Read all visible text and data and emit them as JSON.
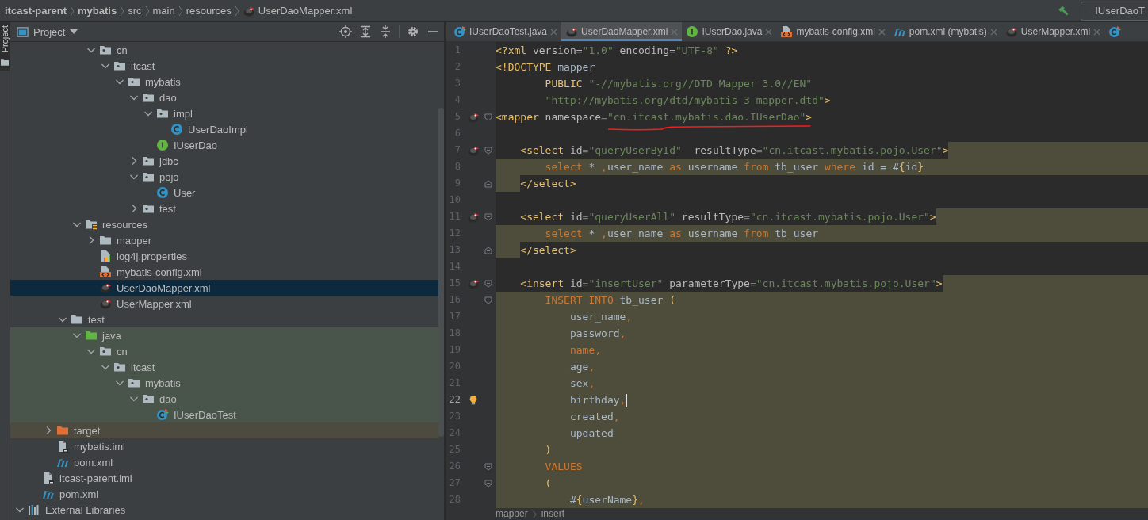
{
  "navbar": {
    "crumbs": [
      {
        "label": "itcast-parent",
        "kind": "module"
      },
      {
        "label": "mybatis",
        "kind": "module"
      },
      {
        "label": "src",
        "kind": "folder"
      },
      {
        "label": "main",
        "kind": "folder"
      },
      {
        "label": "resources",
        "kind": "folder"
      },
      {
        "label": "UserDaoMapper.xml",
        "kind": "mapper-file"
      }
    ],
    "run_config": {
      "label": "IUserDaoT"
    }
  },
  "tool_stripe": [
    {
      "label": "Project",
      "selected": true
    }
  ],
  "project": {
    "title": "Project",
    "tree": [
      {
        "children": [
          {
            "children": [
              {
                "children": [
                  {
                    "children": [
                      {
                        "children": [
                          {
                            "label": "cn",
                            "kind": "package",
                            "expanded": true,
                            "selected": false,
                            "children": [
                              {
                                "label": "itcast",
                                "kind": "package",
                                "expanded": true,
                                "selected": false,
                                "children": [
                                  {
                                    "label": "mybatis",
                                    "kind": "package",
                                    "expanded": true,
                                    "selected": false,
                                    "children": [
                                      {
                                        "label": "dao",
                                        "kind": "package",
                                        "expanded": true,
                                        "selected": false,
                                        "children": [
                                          {
                                            "label": "impl",
                                            "kind": "package",
                                            "expanded": true,
                                            "selected": false,
                                            "children": [
                                              {
                                                "label": "UserDaoImpl",
                                                "kind": "java-class",
                                                "selected": false
                                              }
                                            ]
                                          },
                                          {
                                            "label": "IUserDao",
                                            "kind": "interface",
                                            "selected": false
                                          }
                                        ]
                                      },
                                      {
                                        "label": "jdbc",
                                        "kind": "package",
                                        "expanded": false,
                                        "selected": false
                                      },
                                      {
                                        "label": "pojo",
                                        "kind": "package",
                                        "expanded": true,
                                        "selected": false,
                                        "children": [
                                          {
                                            "label": "User",
                                            "kind": "java-class",
                                            "selected": false
                                          }
                                        ]
                                      },
                                      {
                                        "label": "test",
                                        "kind": "package",
                                        "expanded": false,
                                        "selected": false
                                      }
                                    ]
                                  }
                                ]
                              }
                            ]
                          }
                        ]
                      },
                      {
                        "label": "resources",
                        "kind": "resources",
                        "expanded": true,
                        "selected": false,
                        "children": [
                          {
                            "label": "mapper",
                            "kind": "folder",
                            "expanded": false,
                            "selected": false
                          },
                          {
                            "label": "log4j.properties",
                            "kind": "properties",
                            "selected": false
                          },
                          {
                            "label": "mybatis-config.xml",
                            "kind": "xml-config",
                            "selected": false
                          },
                          {
                            "label": "UserDaoMapper.xml",
                            "kind": "mybatis",
                            "selected": true
                          },
                          {
                            "label": "UserMapper.xml",
                            "kind": "mybatis",
                            "selected": false
                          }
                        ]
                      }
                    ]
                  },
                  {
                    "label": "test",
                    "kind": "folder",
                    "expanded": true,
                    "selected": false,
                    "children": [
                      {
                        "label": "java",
                        "kind": "test-root",
                        "expanded": true,
                        "selected": false,
                        "children": [
                          {
                            "label": "cn",
                            "kind": "package",
                            "expanded": true,
                            "selected": false,
                            "children": [
                              {
                                "label": "itcast",
                                "kind": "package",
                                "expanded": true,
                                "selected": false,
                                "children": [
                                  {
                                    "label": "mybatis",
                                    "kind": "package",
                                    "expanded": true,
                                    "selected": false,
                                    "children": [
                                      {
                                        "label": "dao",
                                        "kind": "package",
                                        "expanded": true,
                                        "selected": false,
                                        "children": [
                                          {
                                            "label": "IUserDaoTest",
                                            "kind": "test-class",
                                            "selected": false
                                          }
                                        ]
                                      }
                                    ]
                                  }
                                ]
                              }
                            ]
                          }
                        ]
                      }
                    ]
                  }
                ]
              },
              {
                "label": "target",
                "kind": "excluded",
                "expanded": false,
                "selected": false
              },
              {
                "label": "mybatis.iml",
                "kind": "iml",
                "selected": false
              },
              {
                "label": "pom.xml",
                "kind": "maven",
                "selected": false
              }
            ]
          },
          {
            "label": "itcast-parent.iml",
            "kind": "iml",
            "selected": false
          },
          {
            "label": "pom.xml",
            "kind": "maven",
            "selected": false
          }
        ]
      },
      {
        "label": "External Libraries",
        "kind": "libraries",
        "expanded": true,
        "selected": false
      }
    ]
  },
  "editor": {
    "tabs": [
      {
        "label": "IUserDaoTest.java",
        "kind": "test-class",
        "selected": false
      },
      {
        "label": "UserDaoMapper.xml",
        "kind": "mybatis",
        "selected": true
      },
      {
        "label": "IUserDao.java",
        "kind": "interface",
        "selected": false
      },
      {
        "label": "mybatis-config.xml",
        "kind": "xml-config",
        "selected": false
      },
      {
        "label": "pom.xml (mybatis)",
        "kind": "maven",
        "selected": false
      },
      {
        "label": "UserMapper.xml",
        "kind": "mybatis",
        "selected": false
      },
      {
        "kind": "test-class",
        "selected": false
      }
    ],
    "lines": [
      {
        "n": "1",
        "current": false,
        "code": [
          {
            "kind": "tag",
            "text": "<?xml"
          },
          {
            "kind": "attr",
            "text": " version"
          },
          {
            "kind": "plain",
            "text": "="
          },
          {
            "kind": "str",
            "text": "\"1.0\""
          },
          {
            "kind": "attr",
            "text": " encoding"
          },
          {
            "kind": "plain",
            "text": "="
          },
          {
            "kind": "str",
            "text": "\"UTF-8\""
          },
          {
            "kind": "tag",
            "text": " ?>"
          }
        ]
      },
      {
        "n": "2",
        "current": false,
        "code": [
          {
            "kind": "tag",
            "text": "<!DOCTYPE"
          },
          {
            "kind": "plain",
            "text": " mapper"
          }
        ]
      },
      {
        "n": "3",
        "current": false,
        "code": [
          {
            "kind": "tag",
            "text": "        PUBLIC"
          },
          {
            "kind": "str",
            "text": " \"-//mybatis.org//DTD Mapper 3.0//EN\""
          }
        ]
      },
      {
        "n": "4",
        "current": false,
        "code": [
          {
            "kind": "str",
            "text": "        \"http://mybatis.org/dtd/mybatis-3-mapper.dtd\""
          },
          {
            "kind": "tag",
            "text": ">"
          }
        ]
      },
      {
        "n": "5",
        "current": false,
        "gutter_icon": {
          "kind": "mybatis"
        },
        "fold_marker": {
          "kind": "open"
        },
        "annotation": {
          "kind": "underline"
        },
        "code": [
          {
            "kind": "tag",
            "text": "<mapper"
          },
          {
            "kind": "attr",
            "text": " namespace"
          },
          {
            "kind": "str",
            "text": "=\"cn.itcast.mybatis.dao.IUserDao\""
          },
          {
            "kind": "tag",
            "text": ">"
          }
        ]
      },
      {
        "n": "6",
        "current": false
      },
      {
        "n": "7",
        "current": false,
        "gutter_icon": {
          "kind": "mybatis"
        },
        "fold_marker": {
          "kind": "open"
        },
        "highlight": {
          "kind": "after"
        },
        "code": [
          {
            "kind": "tag",
            "text": "    <select"
          },
          {
            "kind": "attr",
            "text": " id"
          },
          {
            "kind": "str",
            "text": "=\"queryUserById\""
          },
          {
            "kind": "attr",
            "text": "  resultType"
          },
          {
            "kind": "str",
            "text": "=\"cn.itcast.mybatis.pojo.User\""
          },
          {
            "kind": "tag",
            "text": ">"
          }
        ]
      },
      {
        "n": "8",
        "current": false,
        "highlight": {
          "kind": "full"
        },
        "code": [
          {
            "kind": "kw",
            "text": "        select"
          },
          {
            "kind": "plain",
            "text": " * "
          },
          {
            "kind": "kw",
            "text": ","
          },
          {
            "kind": "plain",
            "text": "user_name "
          },
          {
            "kind": "kw",
            "text": "as"
          },
          {
            "kind": "plain",
            "text": " username "
          },
          {
            "kind": "kw",
            "text": "from"
          },
          {
            "kind": "plain",
            "text": " tb_user "
          },
          {
            "kind": "kw",
            "text": "where"
          },
          {
            "kind": "plain",
            "text": " id = #"
          },
          {
            "kind": "tag",
            "text": "{"
          },
          {
            "kind": "plain",
            "text": "id"
          },
          {
            "kind": "tag",
            "text": "}"
          }
        ]
      },
      {
        "n": "9",
        "current": false,
        "fold_marker": {
          "kind": "close"
        },
        "highlight": {
          "kind": "indent"
        },
        "code": [
          {
            "kind": "tag",
            "text": "    </select>"
          }
        ]
      },
      {
        "n": "10",
        "current": false
      },
      {
        "n": "11",
        "current": false,
        "gutter_icon": {
          "kind": "mybatis"
        },
        "fold_marker": {
          "kind": "open"
        },
        "highlight": {
          "kind": "after"
        },
        "code": [
          {
            "kind": "tag",
            "text": "    <select"
          },
          {
            "kind": "attr",
            "text": " id"
          },
          {
            "kind": "str",
            "text": "=\"queryUserAll\""
          },
          {
            "kind": "attr",
            "text": " resultType"
          },
          {
            "kind": "str",
            "text": "=\"cn.itcast.mybatis.pojo.User\""
          },
          {
            "kind": "tag",
            "text": ">"
          }
        ]
      },
      {
        "n": "12",
        "current": false,
        "highlight": {
          "kind": "full"
        },
        "code": [
          {
            "kind": "kw",
            "text": "        select"
          },
          {
            "kind": "plain",
            "text": " * "
          },
          {
            "kind": "kw",
            "text": ","
          },
          {
            "kind": "plain",
            "text": "user_name "
          },
          {
            "kind": "kw",
            "text": "as"
          },
          {
            "kind": "plain",
            "text": " username "
          },
          {
            "kind": "kw",
            "text": "from"
          },
          {
            "kind": "plain",
            "text": " tb_user"
          }
        ]
      },
      {
        "n": "13",
        "current": false,
        "fold_marker": {
          "kind": "close"
        },
        "highlight": {
          "kind": "indent"
        },
        "code": [
          {
            "kind": "tag",
            "text": "    </select>"
          }
        ]
      },
      {
        "n": "14",
        "current": false
      },
      {
        "n": "15",
        "current": false,
        "gutter_icon": {
          "kind": "mybatis"
        },
        "fold_marker": {
          "kind": "open"
        },
        "highlight": {
          "kind": "after"
        },
        "code": [
          {
            "kind": "tag",
            "text": "    <insert"
          },
          {
            "kind": "attr",
            "text": " id"
          },
          {
            "kind": "str",
            "text": "=\"insertUser\""
          },
          {
            "kind": "attr",
            "text": " parameterType"
          },
          {
            "kind": "str",
            "text": "=\"cn.itcast.mybatis.pojo.User\""
          },
          {
            "kind": "tag",
            "text": ">"
          }
        ]
      },
      {
        "n": "16",
        "current": false,
        "fold_marker": {
          "kind": "open"
        },
        "highlight": {
          "kind": "full"
        },
        "code": [
          {
            "kind": "kw",
            "text": "        INSERT INTO"
          },
          {
            "kind": "plain",
            "text": " tb_user "
          },
          {
            "kind": "tag",
            "text": "("
          }
        ]
      },
      {
        "n": "17",
        "current": false,
        "highlight": {
          "kind": "full"
        },
        "code": [
          {
            "kind": "plain",
            "text": "            user_name"
          },
          {
            "kind": "kw",
            "text": ","
          }
        ]
      },
      {
        "n": "18",
        "current": false,
        "highlight": {
          "kind": "full"
        },
        "code": [
          {
            "kind": "plain",
            "text": "            password"
          },
          {
            "kind": "kw",
            "text": ","
          }
        ]
      },
      {
        "n": "19",
        "current": false,
        "highlight": {
          "kind": "full"
        },
        "code": [
          {
            "kind": "kw",
            "text": "            name,"
          }
        ]
      },
      {
        "n": "20",
        "current": false,
        "highlight": {
          "kind": "full"
        },
        "code": [
          {
            "kind": "plain",
            "text": "            age"
          },
          {
            "kind": "kw",
            "text": ","
          }
        ]
      },
      {
        "n": "21",
        "current": false,
        "highlight": {
          "kind": "full"
        },
        "code": [
          {
            "kind": "plain",
            "text": "            sex"
          },
          {
            "kind": "kw",
            "text": ","
          }
        ]
      },
      {
        "n": "22",
        "current": true,
        "gutter_icon": {
          "kind": "bulb"
        },
        "highlight": {
          "kind": "full"
        },
        "code": [
          {
            "kind": "plain",
            "text": "            birthday"
          },
          {
            "kind": "kw",
            "text": ","
          }
        ]
      },
      {
        "n": "23",
        "current": false,
        "highlight": {
          "kind": "full"
        },
        "code": [
          {
            "kind": "plain",
            "text": "            created"
          },
          {
            "kind": "kw",
            "text": ","
          }
        ]
      },
      {
        "n": "24",
        "current": false,
        "highlight": {
          "kind": "full"
        },
        "code": [
          {
            "kind": "plain",
            "text": "            updated"
          }
        ]
      },
      {
        "n": "25",
        "current": false,
        "highlight": {
          "kind": "full"
        },
        "code": [
          {
            "kind": "tag",
            "text": "        )"
          }
        ]
      },
      {
        "n": "26",
        "current": false,
        "fold_marker": {
          "kind": "open"
        },
        "highlight": {
          "kind": "full"
        },
        "code": [
          {
            "kind": "kw",
            "text": "        VALUES"
          }
        ]
      },
      {
        "n": "27",
        "current": false,
        "fold_marker": {
          "kind": "open"
        },
        "highlight": {
          "kind": "full"
        },
        "code": [
          {
            "kind": "tag",
            "text": "        ("
          }
        ]
      },
      {
        "n": "28",
        "current": false,
        "highlight": {
          "kind": "full"
        },
        "code": [
          {
            "kind": "plain",
            "text": "            #"
          },
          {
            "kind": "tag",
            "text": "{"
          },
          {
            "kind": "plain",
            "text": "userName"
          },
          {
            "kind": "tag",
            "text": "}"
          },
          {
            "kind": "kw",
            "text": ","
          }
        ]
      }
    ],
    "breadcrumbs": [
      "mapper",
      "insert"
    ]
  }
}
